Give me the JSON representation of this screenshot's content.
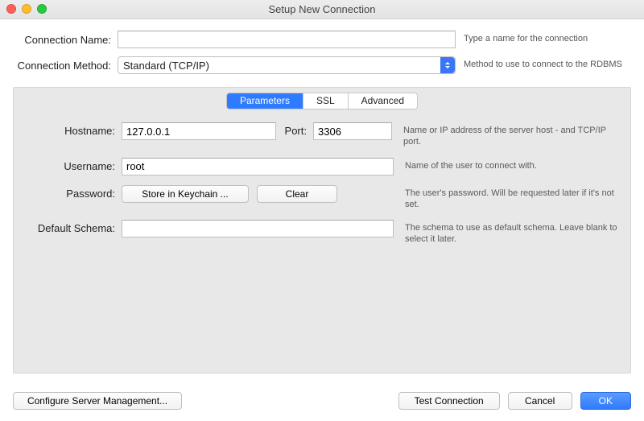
{
  "window": {
    "title": "Setup New Connection"
  },
  "top": {
    "conn_name_label": "Connection Name:",
    "conn_name_value": "",
    "conn_name_hint": "Type a name for the connection",
    "conn_method_label": "Connection Method:",
    "conn_method_value": "Standard (TCP/IP)",
    "conn_method_hint": "Method to use to connect to the RDBMS"
  },
  "tabs": {
    "parameters": "Parameters",
    "ssl": "SSL",
    "advanced": "Advanced"
  },
  "params": {
    "hostname_label": "Hostname:",
    "hostname_value": "127.0.0.1",
    "port_label": "Port:",
    "port_value": "3306",
    "host_hint": "Name or IP address of the server host - and TCP/IP port.",
    "username_label": "Username:",
    "username_value": "root",
    "username_hint": "Name of the user to connect with.",
    "password_label": "Password:",
    "store_btn": "Store in Keychain ...",
    "clear_btn": "Clear",
    "password_hint": "The user's password. Will be requested later if it's not set.",
    "schema_label": "Default Schema:",
    "schema_value": "",
    "schema_hint": "The schema to use as default schema. Leave blank to select it later."
  },
  "footer": {
    "configure": "Configure Server Management...",
    "test": "Test Connection",
    "cancel": "Cancel",
    "ok": "OK"
  }
}
